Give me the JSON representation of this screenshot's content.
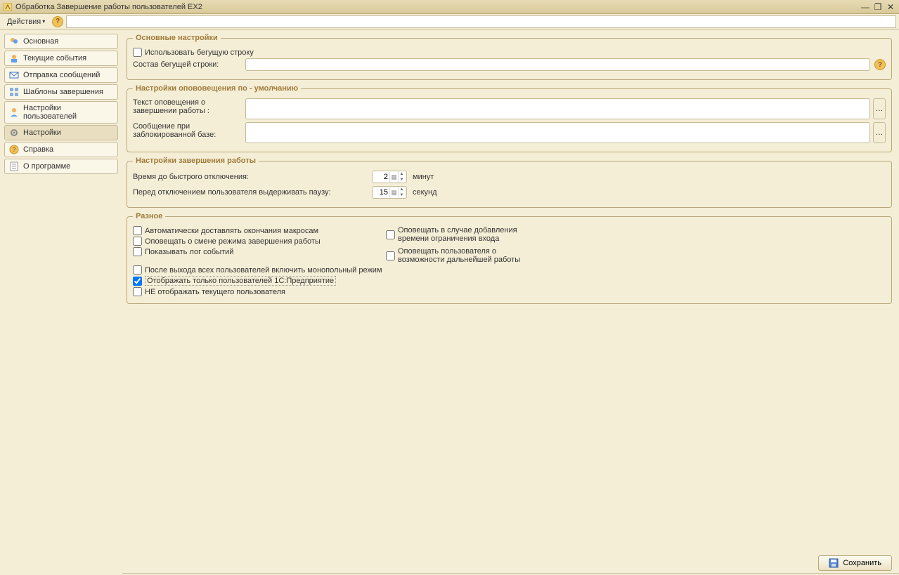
{
  "titlebar": {
    "text": "Обработка  Завершение работы пользователей EX2"
  },
  "toolbar": {
    "actions_label": "Действия"
  },
  "sidebar": {
    "items": [
      {
        "label": "Основная"
      },
      {
        "label": "Текущие события"
      },
      {
        "label": "Отправка сообщений"
      },
      {
        "label": "Шаблоны завершения"
      },
      {
        "label": "Настройки пользователей"
      },
      {
        "label": "Настройки"
      },
      {
        "label": "Справка"
      },
      {
        "label": "О программе"
      }
    ]
  },
  "groups": {
    "main_settings": {
      "legend": "Основные настройки",
      "use_ticker": "Использовать бегущую строку",
      "ticker_content_label": "Состав бегущей строки:"
    },
    "defaults": {
      "legend": "Настройки опововещения по - умолчанию",
      "notify_text_label": "Текст оповещения о завершении работы :",
      "locked_msg_label": "Сообщение при заблокированной базе:"
    },
    "shutdown": {
      "legend": "Настройки завершения работы",
      "fast_off_label": "Время до быстрого отключения:",
      "fast_off_value": "2",
      "fast_off_unit": "минут",
      "pause_label": "Перед отключением пользователя выдерживать паузу:",
      "pause_value": "15",
      "pause_unit": "секунд"
    },
    "misc": {
      "legend": "Разное",
      "cb1": "Автоматически доставлять окончания макросам",
      "cb2": "Оповещать о смене режима завершения работы",
      "cb3": "Показывать лог событий",
      "cb4": "После выхода всех пользователей включить монопольный режим",
      "cb5": "Отображать только пользователей 1С:Предприятие",
      "cb6": "НЕ отображать текущего пользователя",
      "cbR1": "Оповещать в случае добавления времени ограничения входа",
      "cbR2": "Оповещать пользователя о возможности дальнейшей работы"
    }
  },
  "footer": {
    "save_label": "Сохранить"
  }
}
